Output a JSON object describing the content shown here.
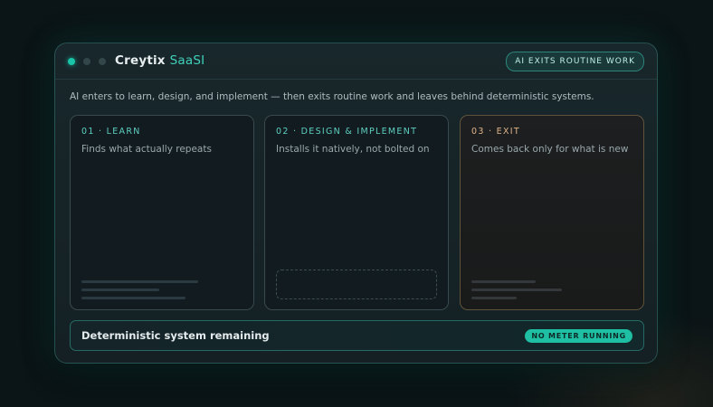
{
  "window": {
    "brand_name": "Creytix",
    "brand_suffix": "SaaSI",
    "badge": "AI EXITS ROUTINE WORK"
  },
  "intro": "AI enters to learn, design, and implement — then exits routine work and leaves behind deterministic systems.",
  "cards": [
    {
      "step": "01 · LEARN",
      "description": "Finds what actually repeats"
    },
    {
      "step": "02 · DESIGN & IMPLEMENT",
      "description": "Installs it natively, not bolted on"
    },
    {
      "step": "03 · EXIT",
      "description": "Comes back only for what is new"
    }
  ],
  "footer": {
    "label": "Deterministic system remaining",
    "status": "NO METER RUNNING"
  },
  "colors": {
    "accent": "#3fd1bb",
    "exit_accent": "#e0b48a",
    "background": "#0b1416"
  },
  "icons": [
    "window-dot-active",
    "window-dot",
    "window-dot"
  ]
}
